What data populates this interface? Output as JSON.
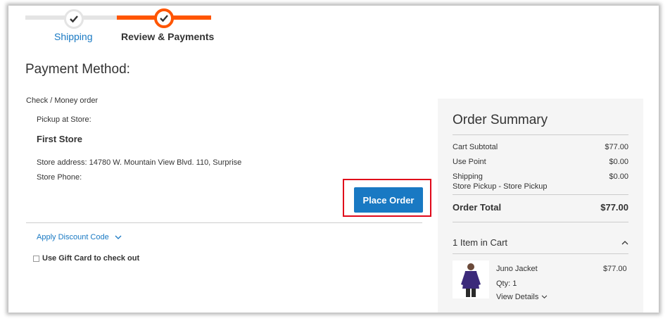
{
  "progress": {
    "steps": [
      {
        "label": "Shipping"
      },
      {
        "label": "Review & Payments"
      }
    ]
  },
  "payment": {
    "title": "Payment Method:",
    "method_label": "Check / Money order",
    "pickup_label": "Pickup at Store:",
    "store_name": "First Store",
    "store_address": "Store address: 14780 W. Mountain View Blvd. 110, Surprise",
    "store_phone": "Store Phone:",
    "place_order_label": "Place Order",
    "discount_label": "Apply Discount Code",
    "gift_card_label": "Use Gift Card to check out"
  },
  "summary": {
    "title": "Order Summary",
    "rows": [
      {
        "label": "Cart Subtotal",
        "value": "$77.00"
      },
      {
        "label": "Use Point",
        "value": "$0.00"
      },
      {
        "label": "Shipping",
        "value": "$0.00"
      }
    ],
    "shipping_method": "Store Pickup - Store Pickup",
    "total_label": "Order Total",
    "total_value": "$77.00",
    "items_in_cart": "1 Item in Cart",
    "item": {
      "name": "Juno Jacket",
      "price": "$77.00",
      "qty": "Qty: 1",
      "details_label": "View Details"
    }
  },
  "colors": {
    "accent": "#1979c3",
    "progress_active": "#ff5501",
    "highlight": "#e0081a"
  },
  "icons": [
    "check-icon",
    "chevron-down-icon",
    "chevron-up-icon",
    "checkbox-icon"
  ]
}
